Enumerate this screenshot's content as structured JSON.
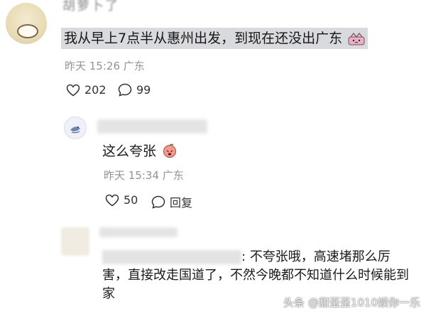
{
  "comment": {
    "author_name": "胡萝卜了",
    "text": "我从早上7点半从惠州出发，到现在还没出广东",
    "timestamp": "昨天 15:26",
    "location": "广东",
    "likes": "202",
    "replies": "99",
    "emoji_icon": "tired-face-emoji-icon"
  },
  "reply_1": {
    "text": "这么夸张",
    "timestamp": "昨天 15:34",
    "location": "广东",
    "likes": "50",
    "reply_label": "回复",
    "emoji_icon": "peach-face-emoji-icon"
  },
  "reply_2": {
    "text_suffix": "不夸张哦，高速堵那么厉害，直接改走国道了，不然今晚都不知道什么时候能到家",
    "separator": ":"
  },
  "watermark": {
    "text": "头条 @甜歪歪1010娱你一乐"
  },
  "colors": {
    "highlight_bg": "#d9dadd",
    "meta_text": "#8f939b",
    "body_text": "#1a1a1a"
  }
}
